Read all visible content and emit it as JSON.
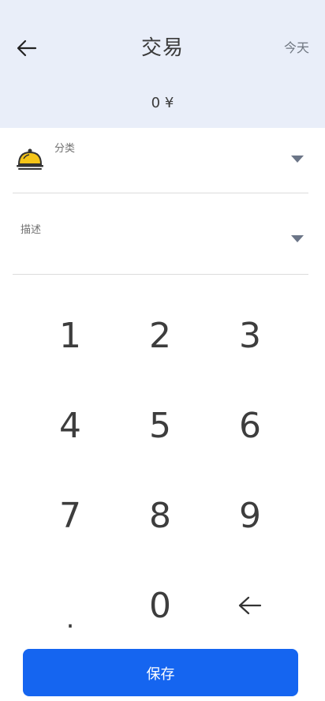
{
  "header": {
    "title": "交易",
    "date_label": "今天",
    "amount": "0 ¥",
    "back_icon": "arrow-left-icon",
    "background": "#e9eef9"
  },
  "form": {
    "category_label": "分类",
    "category_icon": "service-bell-icon",
    "description_label": "描述",
    "dropdown_icon": "caret-down-icon"
  },
  "keypad": {
    "keys": [
      "1",
      "2",
      "3",
      "4",
      "5",
      "6",
      "7",
      "8",
      "9",
      ".",
      "0"
    ],
    "backspace_icon": "backspace-arrow-icon"
  },
  "actions": {
    "save_label": "保存",
    "save_color": "#1565f0"
  }
}
